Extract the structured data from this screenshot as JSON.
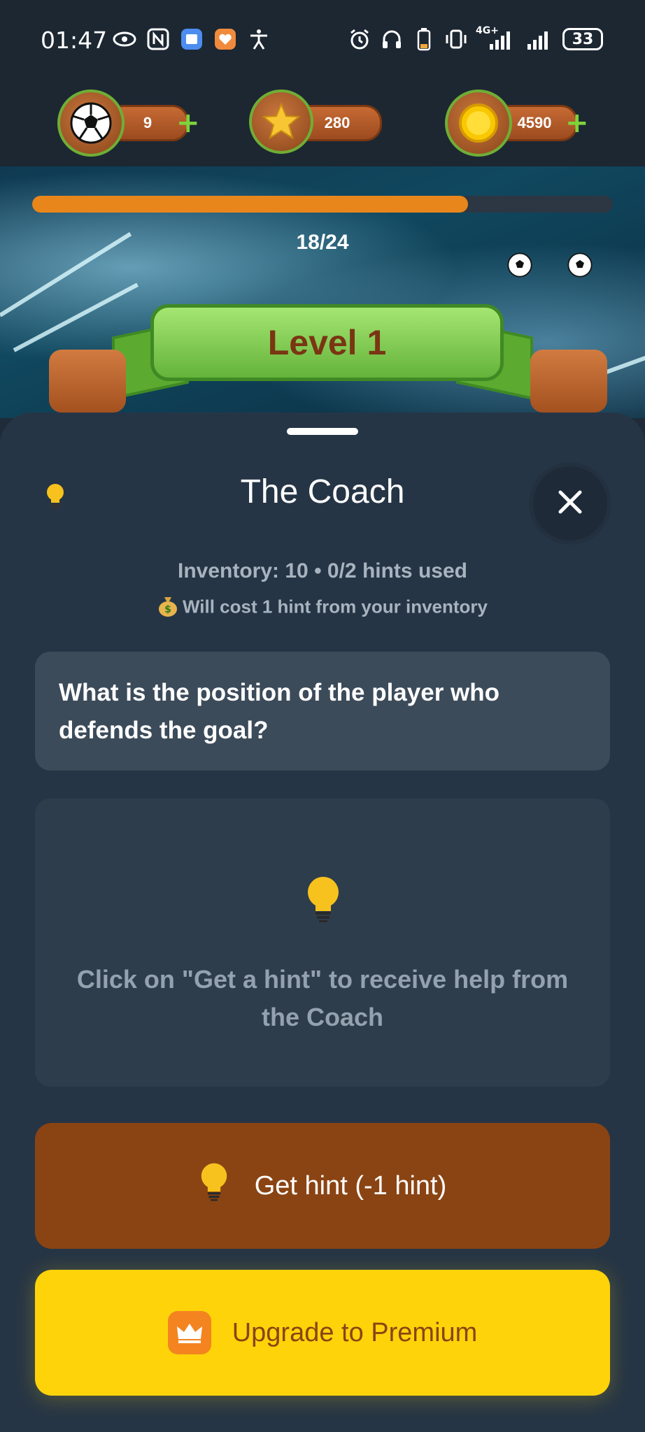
{
  "status_bar": {
    "time": "01:47",
    "network_label": "4G+",
    "battery_level": "33"
  },
  "currency": {
    "balls": "9",
    "stars": "280",
    "coins": "4590"
  },
  "level": {
    "progress_current": 18,
    "progress_total": 24,
    "progress_text": "18/24",
    "title": "Level 1"
  },
  "sheet": {
    "title": "The Coach",
    "inventory_text": "Inventory: 10 • 0/2 hints used",
    "cost_text": "Will cost 1 hint from your inventory",
    "question": "What is the position of the player who defends the goal?",
    "hint_placeholder": "Click on \"Get a hint\" to receive help from the Coach",
    "get_hint_label": "Get hint (-1 hint)",
    "premium_label": "Upgrade to Premium"
  },
  "colors": {
    "sheet_bg": "#263545",
    "progress_fill": "#e8861c",
    "get_hint_bg": "#8a4413",
    "premium_bg": "#fed30a",
    "level_banner": "#64b33a"
  },
  "icons": [
    "eye-icon",
    "nfc-icon",
    "app-icon",
    "heart-app-icon",
    "accessibility-icon",
    "alarm-icon",
    "headphones-icon",
    "battery-saver-icon",
    "vibrate-icon",
    "signal-icon",
    "soccer-ball-icon",
    "star-icon",
    "coin-icon",
    "plus-icon",
    "lightbulb-icon",
    "close-icon",
    "money-bag-icon",
    "crown-icon"
  ]
}
